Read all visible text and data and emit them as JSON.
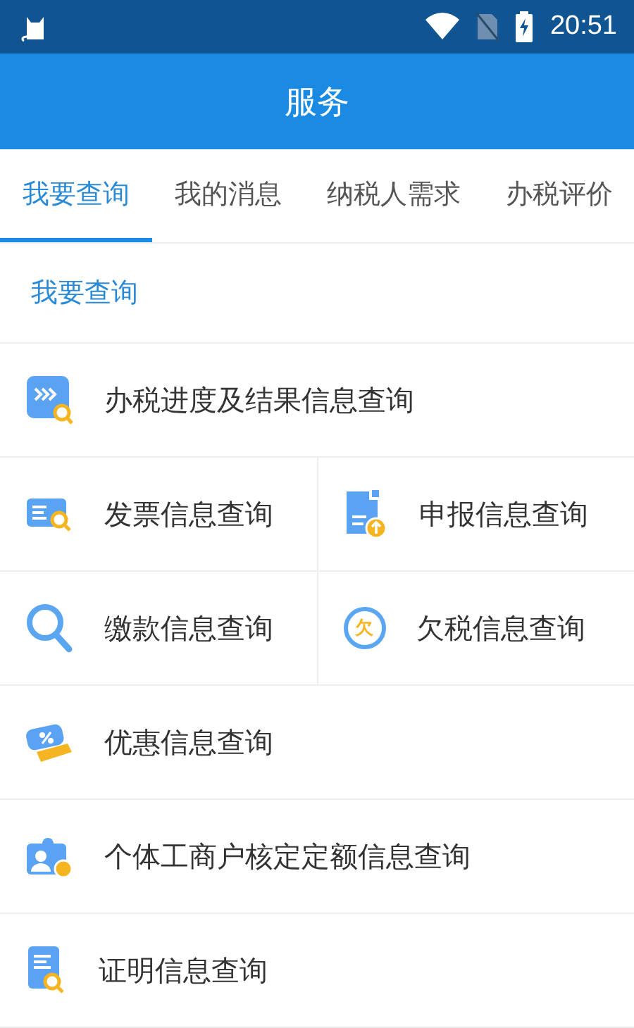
{
  "status_bar": {
    "time": "20:51"
  },
  "app_bar": {
    "title": "服务"
  },
  "tabs": [
    {
      "label": "我要查询",
      "selected": true
    },
    {
      "label": "我的消息",
      "selected": false
    },
    {
      "label": "纳税人需求",
      "selected": false
    },
    {
      "label": "办税评价",
      "selected": false
    }
  ],
  "section_title": "我要查询",
  "menu_rows": [
    {
      "items": [
        {
          "label": "办税进度及结果信息查询"
        }
      ]
    },
    {
      "items": [
        {
          "label": "发票信息查询"
        },
        {
          "label": "申报信息查询"
        }
      ]
    },
    {
      "items": [
        {
          "label": "缴款信息查询"
        },
        {
          "label": "欠税信息查询",
          "icon_text": "欠"
        }
      ]
    },
    {
      "items": [
        {
          "label": "优惠信息查询"
        }
      ]
    },
    {
      "items": [
        {
          "label": "个体工商户核定定额信息查询"
        }
      ]
    },
    {
      "items": [
        {
          "label": "证明信息查询"
        }
      ]
    }
  ]
}
